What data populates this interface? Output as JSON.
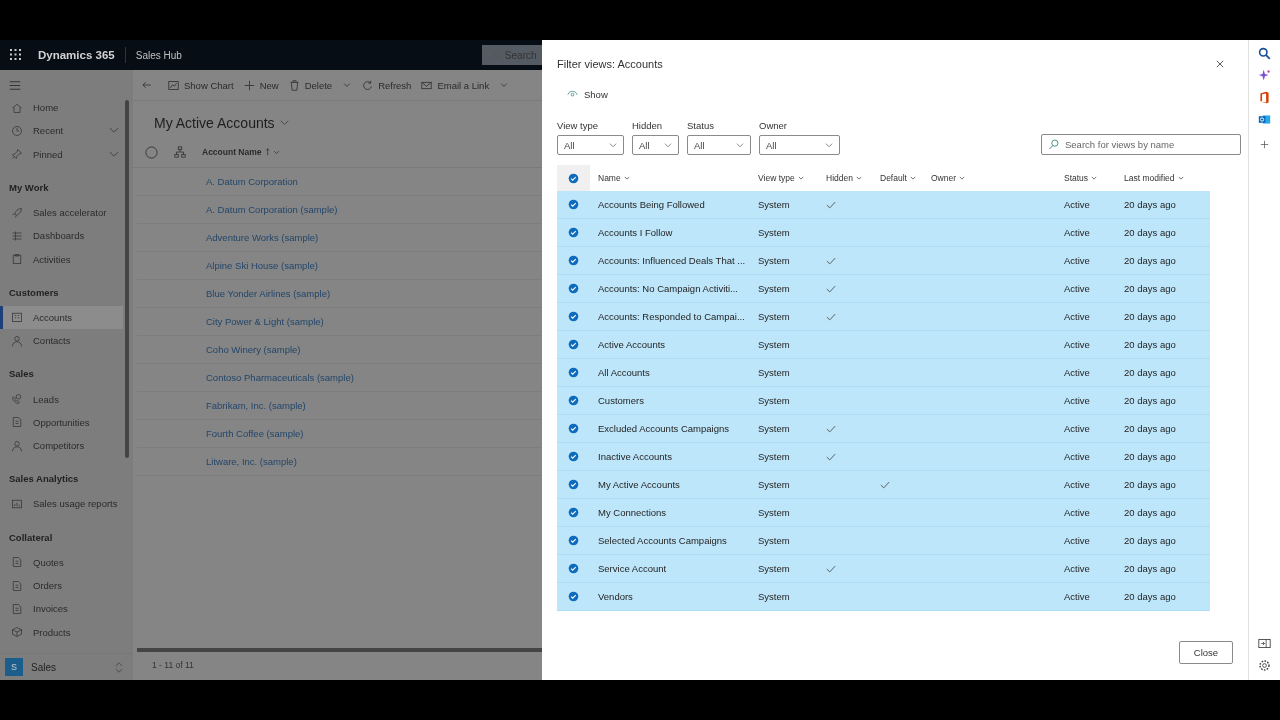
{
  "app": {
    "name": "Dynamics 365",
    "area": "Sales Hub",
    "search_placeholder": "Search"
  },
  "command_bar": [
    {
      "kind": "back"
    },
    {
      "kind": "chart",
      "label": "Show Chart"
    },
    {
      "kind": "new",
      "label": "New"
    },
    {
      "kind": "delete",
      "label": "Delete"
    },
    {
      "kind": "split"
    },
    {
      "kind": "refresh",
      "label": "Refresh"
    },
    {
      "kind": "email",
      "label": "Email a Link"
    },
    {
      "kind": "split"
    }
  ],
  "sidebar": {
    "sections": [
      {
        "items": [
          {
            "kind": "home",
            "label": "Home",
            "expandable": false,
            "selected": false
          },
          {
            "kind": "recent",
            "label": "Recent",
            "expandable": true,
            "selected": false
          },
          {
            "kind": "pinned",
            "label": "Pinned",
            "expandable": true,
            "selected": false
          }
        ]
      },
      {
        "title": "My Work",
        "items": [
          {
            "kind": "rocket",
            "label": "Sales accelerator",
            "expandable": false,
            "selected": false
          },
          {
            "kind": "dashboard",
            "label": "Dashboards",
            "expandable": false,
            "selected": false
          },
          {
            "kind": "clipboard",
            "label": "Activities",
            "expandable": false,
            "selected": false
          }
        ]
      },
      {
        "title": "Customers",
        "items": [
          {
            "kind": "building",
            "label": "Accounts",
            "expandable": false,
            "selected": true
          },
          {
            "kind": "person",
            "label": "Contacts",
            "expandable": false,
            "selected": false
          }
        ]
      },
      {
        "title": "Sales",
        "items": [
          {
            "kind": "phone",
            "label": "Leads",
            "expandable": false,
            "selected": false
          },
          {
            "kind": "doc",
            "label": "Opportunities",
            "expandable": false,
            "selected": false
          },
          {
            "kind": "person",
            "label": "Competitors",
            "expandable": false,
            "selected": false
          }
        ]
      },
      {
        "title": "Sales Analytics",
        "items": [
          {
            "kind": "report",
            "label": "Sales usage reports",
            "expandable": false,
            "selected": false
          }
        ]
      },
      {
        "title": "Collateral",
        "items": [
          {
            "kind": "doc",
            "label": "Quotes",
            "expandable": false,
            "selected": false
          },
          {
            "kind": "doc",
            "label": "Orders",
            "expandable": false,
            "selected": false
          },
          {
            "kind": "doc",
            "label": "Invoices",
            "expandable": false,
            "selected": false
          },
          {
            "kind": "box",
            "label": "Products",
            "expandable": false,
            "selected": false
          }
        ]
      }
    ],
    "area_switcher": {
      "badge": "S",
      "label": "Sales"
    }
  },
  "view": {
    "select_all": false,
    "title": "My Active Accounts",
    "column": "Account Name",
    "rows": [
      "A. Datum Corporation",
      "A. Datum Corporation (sample)",
      "Adventure Works (sample)",
      "Alpine Ski House (sample)",
      "Blue Yonder Airlines (sample)",
      "City Power & Light (sample)",
      "Coho Winery (sample)",
      "Contoso Pharmaceuticals (sample)",
      "Fabrikam, Inc. (sample)",
      "Fourth Coffee (sample)",
      "Litware, Inc. (sample)"
    ],
    "footer": "1 - 11 of 11"
  },
  "dialog": {
    "title": "Filter views: Accounts",
    "show_button": "Show",
    "filters": [
      {
        "label": "View type",
        "value": "All"
      },
      {
        "label": "Hidden",
        "value": "All"
      },
      {
        "label": "Status",
        "value": "All"
      },
      {
        "label": "Owner",
        "value": "All"
      }
    ],
    "search_placeholder": "Search for views by name",
    "select_all": true,
    "columns": [
      "Name",
      "View type",
      "Hidden",
      "Default",
      "Owner",
      "Status",
      "Last modified"
    ],
    "rows": [
      {
        "name": "Accounts Being Followed",
        "view_type": "System",
        "hidden": true,
        "default": false,
        "status": "Active",
        "last_modified": "20 days ago",
        "selected": true
      },
      {
        "name": "Accounts I Follow",
        "view_type": "System",
        "hidden": false,
        "default": false,
        "status": "Active",
        "last_modified": "20 days ago",
        "selected": true
      },
      {
        "name": "Accounts: Influenced Deals That ...",
        "view_type": "System",
        "hidden": true,
        "default": false,
        "status": "Active",
        "last_modified": "20 days ago",
        "selected": true
      },
      {
        "name": "Accounts: No Campaign Activiti...",
        "view_type": "System",
        "hidden": true,
        "default": false,
        "status": "Active",
        "last_modified": "20 days ago",
        "selected": true
      },
      {
        "name": "Accounts: Responded to Campai...",
        "view_type": "System",
        "hidden": true,
        "default": false,
        "status": "Active",
        "last_modified": "20 days ago",
        "selected": true
      },
      {
        "name": "Active Accounts",
        "view_type": "System",
        "hidden": false,
        "default": false,
        "status": "Active",
        "last_modified": "20 days ago",
        "selected": true
      },
      {
        "name": "All Accounts",
        "view_type": "System",
        "hidden": false,
        "default": false,
        "status": "Active",
        "last_modified": "20 days ago",
        "selected": true
      },
      {
        "name": "Customers",
        "view_type": "System",
        "hidden": false,
        "default": false,
        "status": "Active",
        "last_modified": "20 days ago",
        "selected": true
      },
      {
        "name": "Excluded Accounts Campaigns",
        "view_type": "System",
        "hidden": true,
        "default": false,
        "status": "Active",
        "last_modified": "20 days ago",
        "selected": true
      },
      {
        "name": "Inactive Accounts",
        "view_type": "System",
        "hidden": true,
        "default": false,
        "status": "Active",
        "last_modified": "20 days ago",
        "selected": true
      },
      {
        "name": "My Active Accounts",
        "view_type": "System",
        "hidden": false,
        "default": true,
        "status": "Active",
        "last_modified": "20 days ago",
        "selected": true
      },
      {
        "name": "My Connections",
        "view_type": "System",
        "hidden": false,
        "default": false,
        "status": "Active",
        "last_modified": "20 days ago",
        "selected": true
      },
      {
        "name": "Selected Accounts Campaigns",
        "view_type": "System",
        "hidden": false,
        "default": false,
        "status": "Active",
        "last_modified": "20 days ago",
        "selected": true
      },
      {
        "name": "Service Account",
        "view_type": "System",
        "hidden": true,
        "default": false,
        "status": "Active",
        "last_modified": "20 days ago",
        "selected": true
      },
      {
        "name": "Vendors",
        "view_type": "System",
        "hidden": false,
        "default": false,
        "status": "Active",
        "last_modified": "20 days ago",
        "selected": true
      }
    ],
    "close_button": "Close"
  }
}
